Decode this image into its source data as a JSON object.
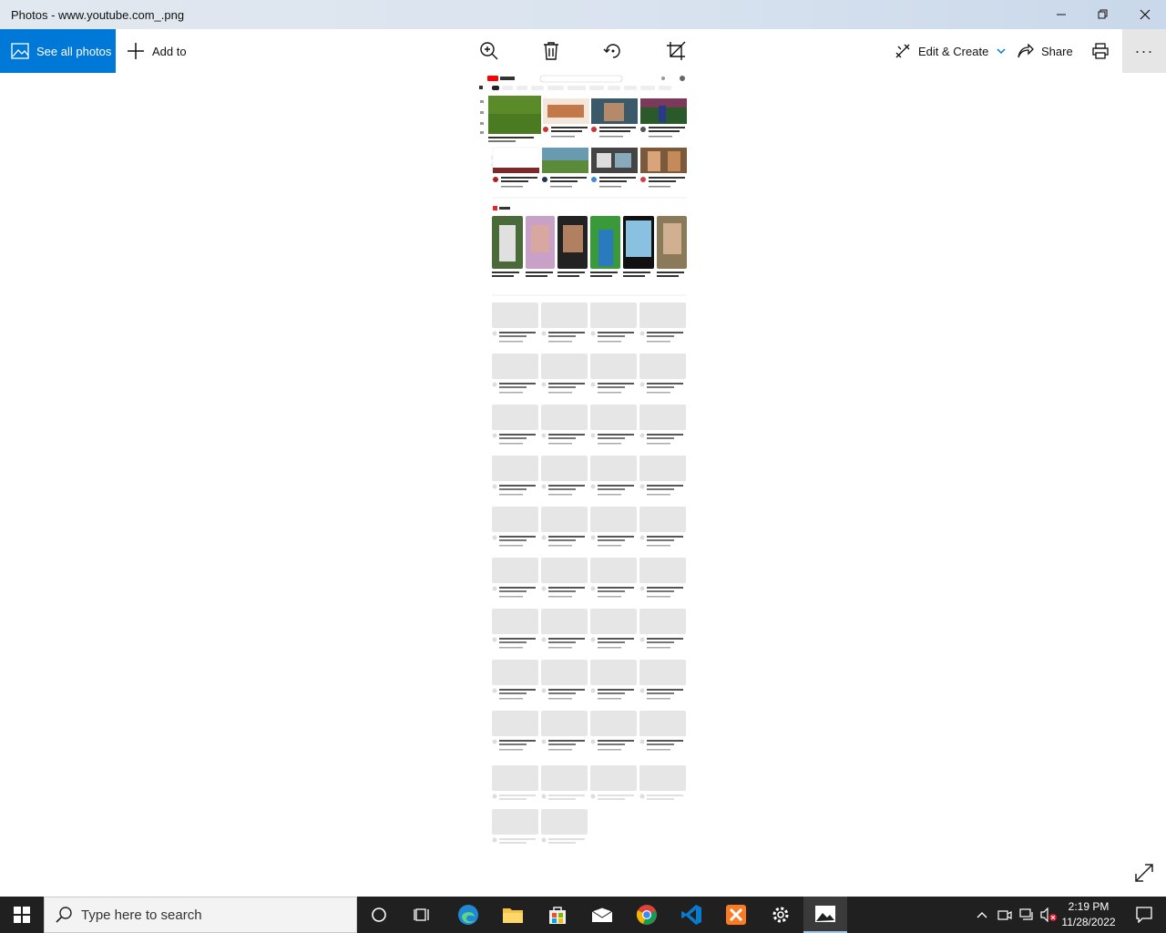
{
  "window": {
    "title": "Photos - www.youtube.com_.png"
  },
  "toolbar": {
    "see_all_label": "See all photos",
    "add_to_label": "Add to",
    "edit_create_label": "Edit & Create",
    "share_label": "Share",
    "more_label": "···"
  },
  "taskbar": {
    "search_placeholder": "Type here to search",
    "time": "2:19 PM",
    "date": "11/28/2022"
  },
  "colors": {
    "accent": "#0078d7",
    "taskbar": "#202020"
  }
}
